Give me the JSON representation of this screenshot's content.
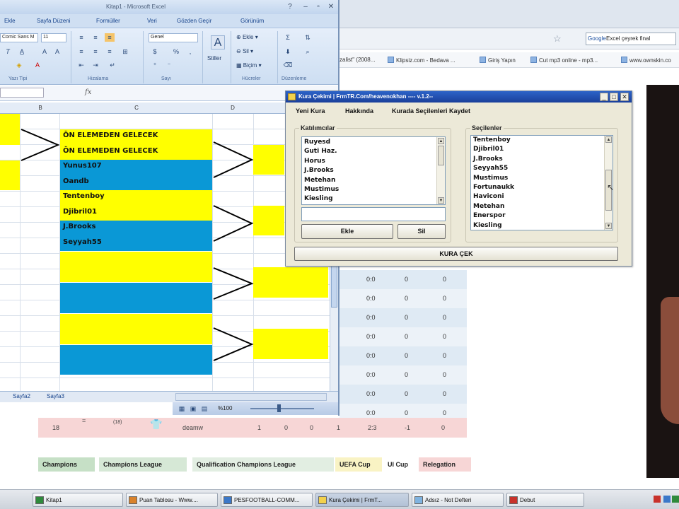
{
  "browser": {
    "search_engine": "Google",
    "search_text": "Excel çeyrek final",
    "bookmarks": [
      "zalist\" (2008...",
      "Klipsiz.com - Bedava ...",
      "Giriş Yapın",
      "Cut mp3 online - mp3...",
      "www.ownskin.co"
    ],
    "score_rows": [
      [
        "0:0",
        "0",
        "0"
      ],
      [
        "0:0",
        "0",
        "0"
      ],
      [
        "0:0",
        "0",
        "0"
      ],
      [
        "0:0",
        "0",
        "0"
      ],
      [
        "0:0",
        "0",
        "0"
      ],
      [
        "0:0",
        "0",
        "0"
      ],
      [
        "0:0",
        "0",
        "0"
      ],
      [
        "0:0",
        "0",
        "0"
      ]
    ],
    "last_row": {
      "rank": "18",
      "marker": "=",
      "prev": "(18)",
      "team": "deamw",
      "played": "1",
      "won": "0",
      "drawn": "0",
      "lost": "1",
      "goals": "2:3",
      "diff": "-1",
      "points": "0"
    },
    "legend": [
      {
        "label": "Champions",
        "color": "#c6e0c6"
      },
      {
        "label": "Champions League",
        "color": "#d6e8d6"
      },
      {
        "label": "Qualification Champions League",
        "color": "#e2eee2"
      },
      {
        "label": "UEFA Cup",
        "color": "#f9f3c4"
      },
      {
        "label": "UI Cup",
        "color": "#ffffff"
      },
      {
        "label": "Relegation",
        "color": "#f7d6d6"
      }
    ]
  },
  "excel": {
    "title": "Kitap1 - Microsoft Excel",
    "menu": [
      "Ekle",
      "Sayfa Düzeni",
      "Formüller",
      "Veri",
      "Gözden Geçir",
      "Görünüm"
    ],
    "font_name": "Comic Sans M",
    "font_size": "11",
    "number_format": "Genel",
    "ribbon_labels": {
      "styles": "Stiller",
      "insert": "Ekle",
      "delete": "Sil",
      "format": "Biçim",
      "font_group": "Yazı Tipi",
      "align_group": "Hizalama",
      "number_group": "Sayı",
      "cells_group": "Hücreler",
      "edit_group": "Düzenleme"
    },
    "fx": "fx",
    "columns": [
      "B",
      "C",
      "D"
    ],
    "cells": [
      "ÖN ELEMEDEN GELECEK",
      "ÖN ELEMEDEN GELECEK",
      "Yunus107",
      "Oandb",
      "Tentenboy",
      "Djibril01",
      "J.Brooks",
      "Seyyah55"
    ],
    "sheet_tabs": [
      "Sayfa2",
      "Sayfa3"
    ],
    "zoom": "%100",
    "colors": {
      "yellow": "#ffff00",
      "blue": "#0a98d6"
    }
  },
  "kura": {
    "title": "Kura Çekimi | FrmTR.Com/heavenokhan ---- v.1.2--",
    "menu": [
      "Yeni Kura",
      "Hakkında",
      "Kurada Seçilenleri Kaydet"
    ],
    "participants_label": "Katılımcılar",
    "participants": [
      "Ruyesd",
      "Guti Haz.",
      "Horus",
      "J.Brooks",
      "Metehan",
      "Mustimus",
      "Kiesling"
    ],
    "selected_label": "Seçilenler",
    "selected": [
      "Tentenboy",
      "Djibril01",
      "J.Brooks",
      "Seyyah55",
      "Mustimus",
      "Fortunaukk",
      "Haviconi",
      "Metehan",
      "Enerspor",
      "Kiesling"
    ],
    "add_button": "Ekle",
    "delete_button": "Sil",
    "draw_button": "KURA ÇEK"
  },
  "taskbar": {
    "tasks": [
      "Kitap1",
      "Puan Tablosu - Www....",
      "PESFOOTBALL-COMM...",
      "Kura Çekimi | FrmT...",
      "Adsız - Not Defteri",
      "Debut"
    ]
  }
}
